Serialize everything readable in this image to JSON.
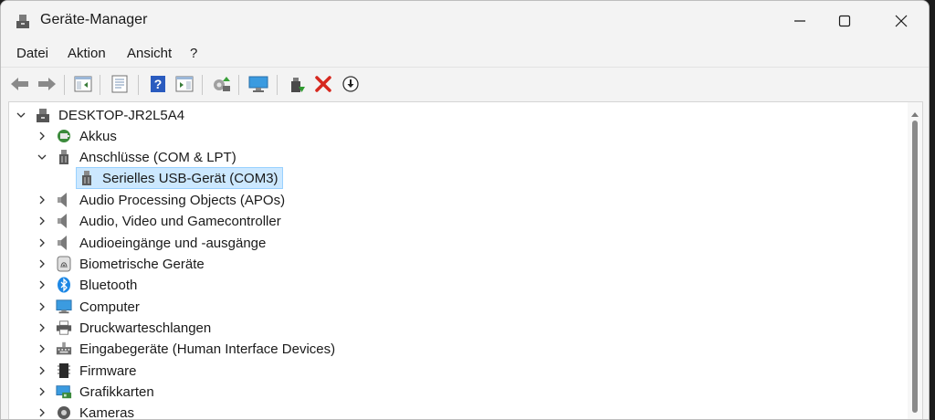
{
  "window": {
    "title": "Geräte-Manager"
  },
  "menu": [
    "Datei",
    "Aktion",
    "Ansicht",
    "?"
  ],
  "toolbar": {
    "icons": [
      "back-arrow-icon",
      "forward-arrow-icon",
      "show-hide-console-tree-icon",
      "properties-icon",
      "help-icon",
      "action-pane-icon",
      "update-driver-icon",
      "scan-hardware-icon",
      "enable-device-icon",
      "uninstall-device-icon",
      "disable-device-icon"
    ]
  },
  "tree": {
    "root": "DESKTOP-JR2L5A4",
    "items": [
      {
        "label": "Akkus",
        "icon": "battery-icon",
        "expanded": false
      },
      {
        "label": "Anschlüsse (COM & LPT)",
        "icon": "port-icon",
        "expanded": true
      },
      {
        "label": "Serielles USB-Gerät (COM3)",
        "icon": "serial-port-icon",
        "child": true,
        "selected": true
      },
      {
        "label": "Audio Processing Objects (APOs)",
        "icon": "speaker-icon"
      },
      {
        "label": "Audio, Video und Gamecontroller",
        "icon": "speaker-icon"
      },
      {
        "label": "Audioeingänge und -ausgänge",
        "icon": "speaker-icon"
      },
      {
        "label": "Biometrische Geräte",
        "icon": "fingerprint-icon"
      },
      {
        "label": "Bluetooth",
        "icon": "bluetooth-icon"
      },
      {
        "label": "Computer",
        "icon": "monitor-icon"
      },
      {
        "label": "Druckwarteschlangen",
        "icon": "printer-icon"
      },
      {
        "label": "Eingabegeräte (Human Interface Devices)",
        "icon": "keyboard-icon"
      },
      {
        "label": "Firmware",
        "icon": "firmware-chip-icon"
      },
      {
        "label": "Grafikkarten",
        "icon": "display-adapter-icon"
      },
      {
        "label": "Kameras",
        "icon": "camera-icon"
      }
    ]
  },
  "colors": {
    "selection_bg": "#cce8ff",
    "selection_border": "#99d1ff",
    "delete_red": "#d6281f",
    "bluetooth_blue": "#1e88e5"
  }
}
